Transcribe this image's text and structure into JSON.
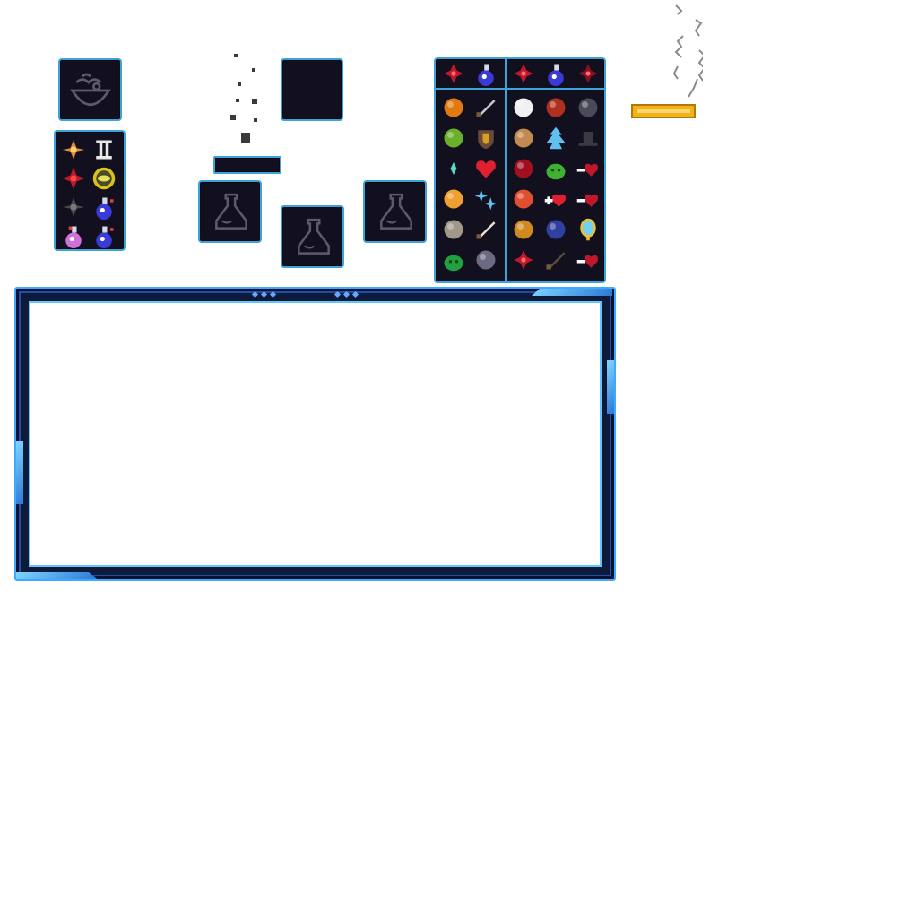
{
  "colors": {
    "panel_bg": "#12101f",
    "panel_border": "#3ba3d9",
    "frame_border": "#3fa9ff",
    "frame_dark": "#0d1a3a",
    "gold_bar": "#f0b21c",
    "smoke": "#8a8a8a"
  },
  "widgets": {
    "crafting_slot": {
      "icon": "mortar-bowl-icon"
    },
    "mini_inventory": {
      "items": [
        "orange-flower-icon",
        "gemini-rune-icon",
        "red-flower-icon",
        "yellow-eye-icon",
        "dark-flower-icon",
        "blue-potion-icon",
        "pink-potion-icon",
        "blue-potion-icon"
      ]
    },
    "falling_dust": {
      "icon": "dust-particles-icon"
    },
    "empty_slot": {
      "icon": "empty-slot"
    },
    "progress_bar": {
      "fill_fraction": 0
    },
    "potion_slots": [
      "flask-outline-icon",
      "flask-outline-icon",
      "flask-outline-icon"
    ],
    "incense": {
      "icon": "incense-stick-icon"
    }
  },
  "inventory": {
    "left_header": [
      "red-flower-icon",
      "blue-potion-icon"
    ],
    "right_header": [
      "red-flower-icon",
      "blue-potion-icon",
      "dark-red-flower-icon"
    ],
    "left_grid": [
      "pumpkin-icon",
      "dagger-icon",
      "melon-icon",
      "shield-icon",
      "crystal-shard-icon",
      "heart-icon",
      "cat-head-icon",
      "sparkle-icon",
      "rock-icon",
      "bone-icon",
      "moss-icon",
      "ore-icon"
    ],
    "right_grid": [
      "garlic-icon",
      "red-bird-icon",
      "dark-mushroom-icon",
      "bread-icon",
      "ice-crystal-icon",
      "black-hat-icon",
      "red-gem-icon",
      "green-slime-icon",
      "health-minus-icon",
      "watermelon-icon",
      "health-plus-icon",
      "health-minus-icon",
      "horn-icon",
      "eye-gem-icon",
      "golden-mirror-icon",
      "red-flower-icon",
      "wand-icon",
      "health-minus-icon"
    ]
  },
  "window": {
    "title": ""
  }
}
